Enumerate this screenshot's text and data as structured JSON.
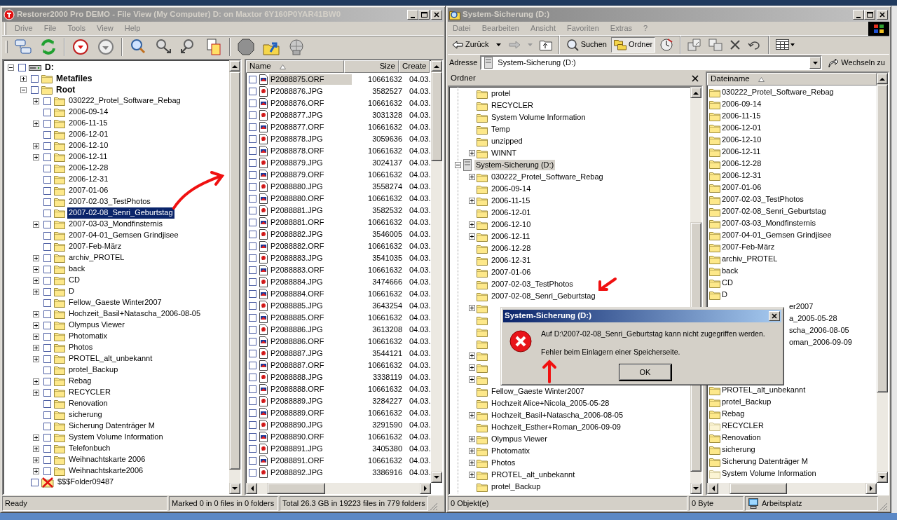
{
  "left_window": {
    "title": "Restorer2000 Pro DEMO - File View (My Computer) D: on Maxtor 6Y160P0YAR41BW0",
    "menu": [
      "Drive",
      "File",
      "Tools",
      "View",
      "Help"
    ],
    "tree": {
      "items": [
        {
          "label": "D:",
          "kind": "drive",
          "expanded": true,
          "checked": false,
          "selected": false,
          "children": [
            {
              "label": "Metafiles",
              "kind": "group",
              "expanded": false,
              "checked": false,
              "selected": false
            },
            {
              "label": "Root",
              "kind": "group",
              "expanded": true,
              "checked": false,
              "selected": false,
              "children": [
                {
                  "label": "030222_Protel_Software_Rebag",
                  "kind": "folder",
                  "expanded": false,
                  "checked": false,
                  "selected": false
                },
                {
                  "label": "2006-09-14",
                  "kind": "folder",
                  "checked": false,
                  "selected": false
                },
                {
                  "label": "2006-11-15",
                  "kind": "folder",
                  "expanded": false,
                  "checked": false,
                  "selected": false
                },
                {
                  "label": "2006-12-01",
                  "kind": "folder",
                  "checked": false,
                  "selected": false
                },
                {
                  "label": "2006-12-10",
                  "kind": "folder",
                  "expanded": false,
                  "checked": false,
                  "selected": false
                },
                {
                  "label": "2006-12-11",
                  "kind": "folder",
                  "expanded": false,
                  "checked": false,
                  "selected": false
                },
                {
                  "label": "2006-12-28",
                  "kind": "folder",
                  "checked": false,
                  "selected": false
                },
                {
                  "label": "2006-12-31",
                  "kind": "folder",
                  "checked": false,
                  "selected": false
                },
                {
                  "label": "2007-01-06",
                  "kind": "folder",
                  "checked": false,
                  "selected": false
                },
                {
                  "label": "2007-02-03_TestPhotos",
                  "kind": "folder",
                  "checked": false,
                  "selected": false
                },
                {
                  "label": "2007-02-08_Senri_Geburtstag",
                  "kind": "folder",
                  "checked": false,
                  "selected": true
                },
                {
                  "label": "2007-03-03_Mondfinsternis",
                  "kind": "folder",
                  "expanded": false,
                  "checked": false,
                  "selected": false
                },
                {
                  "label": "2007-04-01_Gemsen Grindjisee",
                  "kind": "folder",
                  "checked": false,
                  "selected": false
                },
                {
                  "label": "2007-Feb-März",
                  "kind": "folder",
                  "checked": false,
                  "selected": false
                },
                {
                  "label": "archiv_PROTEL",
                  "kind": "folder",
                  "expanded": false,
                  "checked": false,
                  "selected": false
                },
                {
                  "label": "back",
                  "kind": "folder",
                  "expanded": false,
                  "checked": false,
                  "selected": false
                },
                {
                  "label": "CD",
                  "kind": "folder",
                  "expanded": false,
                  "checked": false,
                  "selected": false
                },
                {
                  "label": "D",
                  "kind": "folder",
                  "expanded": false,
                  "checked": false,
                  "selected": false
                },
                {
                  "label": "Fellow_Gaeste Winter2007",
                  "kind": "folder",
                  "checked": false,
                  "selected": false
                },
                {
                  "label": "Hochzeit_Basil+Natascha_2006-08-05",
                  "kind": "folder",
                  "expanded": false,
                  "checked": false,
                  "selected": false
                },
                {
                  "label": "Olympus Viewer",
                  "kind": "folder",
                  "expanded": false,
                  "checked": false,
                  "selected": false
                },
                {
                  "label": "Photomatix",
                  "kind": "folder",
                  "expanded": false,
                  "checked": false,
                  "selected": false
                },
                {
                  "label": "Photos",
                  "kind": "folder",
                  "expanded": false,
                  "checked": false,
                  "selected": false
                },
                {
                  "label": "PROTEL_alt_unbekannt",
                  "kind": "folder",
                  "expanded": false,
                  "checked": false,
                  "selected": false
                },
                {
                  "label": "protel_Backup",
                  "kind": "folder",
                  "checked": false,
                  "selected": false
                },
                {
                  "label": "Rebag",
                  "kind": "folder",
                  "expanded": false,
                  "checked": false,
                  "selected": false
                },
                {
                  "label": "RECYCLER",
                  "kind": "folder",
                  "expanded": false,
                  "checked": false,
                  "selected": false
                },
                {
                  "label": "Renovation",
                  "kind": "folder",
                  "checked": false,
                  "selected": false
                },
                {
                  "label": "sicherung",
                  "kind": "folder",
                  "checked": false,
                  "selected": false
                },
                {
                  "label": "Sicherung Datenträger M",
                  "kind": "folder",
                  "checked": false,
                  "selected": false
                },
                {
                  "label": "System Volume Information",
                  "kind": "folder",
                  "expanded": false,
                  "checked": false,
                  "selected": false
                },
                {
                  "label": "Telefonbuch",
                  "kind": "folder",
                  "expanded": false,
                  "checked": false,
                  "selected": false
                },
                {
                  "label": "Weihnachtskarte 2006",
                  "kind": "folder",
                  "expanded": false,
                  "checked": false,
                  "selected": false
                },
                {
                  "label": "Weihnachtskarte2006",
                  "kind": "folder",
                  "expanded": false,
                  "checked": false,
                  "selected": false
                }
              ]
            },
            {
              "label": "$$$Folder09487",
              "kind": "deleted",
              "checked": false,
              "selected": false
            }
          ]
        }
      ]
    },
    "file_list": {
      "columns": [
        "Name",
        "Size",
        "Create"
      ],
      "rows": [
        {
          "name": "P2088875.ORF",
          "size": "10661632",
          "created": "04.03.",
          "kind": "orf",
          "checked": false,
          "selected": true
        },
        {
          "name": "P2088876.JPG",
          "size": "3582527",
          "created": "04.03.",
          "kind": "jpg",
          "checked": false,
          "selected": false
        },
        {
          "name": "P2088876.ORF",
          "size": "10661632",
          "created": "04.03.",
          "kind": "orf",
          "checked": false,
          "selected": false
        },
        {
          "name": "P2088877.JPG",
          "size": "3031328",
          "created": "04.03.",
          "kind": "jpg",
          "checked": false,
          "selected": false
        },
        {
          "name": "P2088877.ORF",
          "size": "10661632",
          "created": "04.03.",
          "kind": "orf",
          "checked": false,
          "selected": false
        },
        {
          "name": "P2088878.JPG",
          "size": "3059636",
          "created": "04.03.",
          "kind": "jpg",
          "checked": false,
          "selected": false
        },
        {
          "name": "P2088878.ORF",
          "size": "10661632",
          "created": "04.03.",
          "kind": "orf",
          "checked": false,
          "selected": false
        },
        {
          "name": "P2088879.JPG",
          "size": "3024137",
          "created": "04.03.",
          "kind": "jpg",
          "checked": false,
          "selected": false
        },
        {
          "name": "P2088879.ORF",
          "size": "10661632",
          "created": "04.03.",
          "kind": "orf",
          "checked": false,
          "selected": false
        },
        {
          "name": "P2088880.JPG",
          "size": "3558274",
          "created": "04.03.",
          "kind": "jpg",
          "checked": false,
          "selected": false
        },
        {
          "name": "P2088880.ORF",
          "size": "10661632",
          "created": "04.03.",
          "kind": "orf",
          "checked": false,
          "selected": false
        },
        {
          "name": "P2088881.JPG",
          "size": "3582532",
          "created": "04.03.",
          "kind": "jpg",
          "checked": false,
          "selected": false
        },
        {
          "name": "P2088881.ORF",
          "size": "10661632",
          "created": "04.03.",
          "kind": "orf",
          "checked": false,
          "selected": false
        },
        {
          "name": "P2088882.JPG",
          "size": "3546005",
          "created": "04.03.",
          "kind": "jpg",
          "checked": false,
          "selected": false
        },
        {
          "name": "P2088882.ORF",
          "size": "10661632",
          "created": "04.03.",
          "kind": "orf",
          "checked": false,
          "selected": false
        },
        {
          "name": "P2088883.JPG",
          "size": "3541035",
          "created": "04.03.",
          "kind": "jpg",
          "checked": false,
          "selected": false
        },
        {
          "name": "P2088883.ORF",
          "size": "10661632",
          "created": "04.03.",
          "kind": "orf",
          "checked": false,
          "selected": false
        },
        {
          "name": "P2088884.JPG",
          "size": "3474666",
          "created": "04.03.",
          "kind": "jpg",
          "checked": false,
          "selected": false
        },
        {
          "name": "P2088884.ORF",
          "size": "10661632",
          "created": "04.03.",
          "kind": "orf",
          "checked": false,
          "selected": false
        },
        {
          "name": "P2088885.JPG",
          "size": "3643254",
          "created": "04.03.",
          "kind": "jpg",
          "checked": false,
          "selected": false
        },
        {
          "name": "P2088885.ORF",
          "size": "10661632",
          "created": "04.03.",
          "kind": "orf",
          "checked": false,
          "selected": false
        },
        {
          "name": "P2088886.JPG",
          "size": "3613208",
          "created": "04.03.",
          "kind": "jpg",
          "checked": false,
          "selected": false
        },
        {
          "name": "P2088886.ORF",
          "size": "10661632",
          "created": "04.03.",
          "kind": "orf",
          "checked": false,
          "selected": false
        },
        {
          "name": "P2088887.JPG",
          "size": "3544121",
          "created": "04.03.",
          "kind": "jpg",
          "checked": false,
          "selected": false
        },
        {
          "name": "P2088887.ORF",
          "size": "10661632",
          "created": "04.03.",
          "kind": "orf",
          "checked": false,
          "selected": false
        },
        {
          "name": "P2088888.JPG",
          "size": "3338119",
          "created": "04.03.",
          "kind": "jpg",
          "checked": false,
          "selected": false
        },
        {
          "name": "P2088888.ORF",
          "size": "10661632",
          "created": "04.03.",
          "kind": "orf",
          "checked": false,
          "selected": false
        },
        {
          "name": "P2088889.JPG",
          "size": "3284227",
          "created": "04.03.",
          "kind": "jpg",
          "checked": false,
          "selected": false
        },
        {
          "name": "P2088889.ORF",
          "size": "10661632",
          "created": "04.03.",
          "kind": "orf",
          "checked": false,
          "selected": false
        },
        {
          "name": "P2088890.JPG",
          "size": "3291590",
          "created": "04.03.",
          "kind": "jpg",
          "checked": false,
          "selected": false
        },
        {
          "name": "P2088890.ORF",
          "size": "10661632",
          "created": "04.03.",
          "kind": "orf",
          "checked": false,
          "selected": false
        },
        {
          "name": "P2088891.JPG",
          "size": "3405380",
          "created": "04.03.",
          "kind": "jpg",
          "checked": false,
          "selected": false
        },
        {
          "name": "P2088891.ORF",
          "size": "10661632",
          "created": "04.03.",
          "kind": "orf",
          "checked": false,
          "selected": false
        },
        {
          "name": "P2088892.JPG",
          "size": "3386916",
          "created": "04.03.",
          "kind": "jpg",
          "checked": false,
          "selected": false
        }
      ]
    },
    "status_bar": [
      "Ready",
      "Marked 0 in 0 files in 0 folders",
      "Total 26.3 GB in 19223 files in 779 folders"
    ]
  },
  "right_window": {
    "title": "System-Sicherung (D:)",
    "menu": [
      "Datei",
      "Bearbeiten",
      "Ansicht",
      "Favoriten",
      "Extras",
      "?"
    ],
    "toolbar": {
      "buttons": [
        {
          "label": "Zurück",
          "pressed": false
        },
        {
          "label": "Suchen",
          "pressed": false
        },
        {
          "label": "Ordner",
          "pressed": true
        }
      ]
    },
    "address": {
      "label": "Adresse",
      "value": "System-Sicherung (D:)",
      "go_button": "Wechseln zu"
    },
    "folders_pane": {
      "title": "Ordner",
      "items": [
        {
          "kind": "offscreen",
          "children": [
            {
              "label": "protel",
              "kind": "folder",
              "selected": false
            },
            {
              "label": "RECYCLER",
              "kind": "folder",
              "selected": false
            },
            {
              "label": "System Volume Information",
              "kind": "folder",
              "selected": false
            },
            {
              "label": "Temp",
              "kind": "folder",
              "selected": false
            },
            {
              "label": "unzipped",
              "kind": "folder",
              "selected": false
            },
            {
              "label": "WINNT",
              "kind": "folder",
              "expanded": false,
              "selected": false
            }
          ]
        },
        {
          "label": "System-Sicherung (D:)",
          "kind": "drive",
          "expanded": true,
          "selected": true,
          "children": [
            {
              "label": "030222_Protel_Software_Rebag",
              "kind": "folder",
              "expanded": false,
              "selected": false
            },
            {
              "label": "2006-09-14",
              "kind": "folder",
              "selected": false
            },
            {
              "label": "2006-11-15",
              "kind": "folder",
              "expanded": false,
              "selected": false
            },
            {
              "label": "2006-12-01",
              "kind": "folder",
              "selected": false
            },
            {
              "label": "2006-12-10",
              "kind": "folder",
              "expanded": false,
              "selected": false
            },
            {
              "label": "2006-12-11",
              "kind": "folder",
              "expanded": false,
              "selected": false
            },
            {
              "label": "2006-12-28",
              "kind": "folder",
              "selected": false
            },
            {
              "label": "2006-12-31",
              "kind": "folder",
              "selected": false
            },
            {
              "label": "2007-01-06",
              "kind": "folder",
              "selected": false
            },
            {
              "label": "2007-02-03_TestPhotos",
              "kind": "folder",
              "selected": false
            },
            {
              "label": "2007-02-08_Senri_Geburtstag",
              "kind": "folder",
              "selected": false
            },
            {
              "kind": "covered",
              "expanded": false
            },
            {
              "kind": "covered"
            },
            {
              "kind": "covered"
            },
            {
              "kind": "covered"
            },
            {
              "kind": "covered",
              "expanded": false
            },
            {
              "kind": "covered",
              "expanded": false
            },
            {
              "kind": "covered",
              "expanded": false
            },
            {
              "label": "Fellow_Gaeste Winter2007",
              "kind": "folder",
              "selected": false
            },
            {
              "label": "Hochzeit Alice+Nicola_2005-05-28",
              "kind": "folder",
              "selected": false
            },
            {
              "label": "Hochzeit_Basil+Natascha_2006-08-05",
              "kind": "folder",
              "expanded": false,
              "selected": false
            },
            {
              "label": "Hochzeit_Esther+Roman_2006-09-09",
              "kind": "folder",
              "selected": false
            },
            {
              "label": "Olympus Viewer",
              "kind": "folder",
              "expanded": false,
              "selected": false
            },
            {
              "label": "Photomatix",
              "kind": "folder",
              "expanded": false,
              "selected": false
            },
            {
              "label": "Photos",
              "kind": "folder",
              "expanded": false,
              "selected": false
            },
            {
              "label": "PROTEL_alt_unbekannt",
              "kind": "folder",
              "expanded": false,
              "selected": false
            },
            {
              "label": "protel_Backup",
              "kind": "folder",
              "selected": false
            }
          ]
        }
      ]
    },
    "file_list": {
      "columns": [
        "Dateiname"
      ],
      "rows": [
        {
          "name": "030222_Protel_Software_Rebag",
          "kind": "folder",
          "selected": false
        },
        {
          "name": "2006-09-14",
          "kind": "folder",
          "selected": false
        },
        {
          "name": "2006-11-15",
          "kind": "folder",
          "selected": false
        },
        {
          "name": "2006-12-01",
          "kind": "folder",
          "selected": false
        },
        {
          "name": "2006-12-10",
          "kind": "folder",
          "selected": false
        },
        {
          "name": "2006-12-11",
          "kind": "folder",
          "selected": false
        },
        {
          "name": "2006-12-28",
          "kind": "folder",
          "selected": false
        },
        {
          "name": "2006-12-31",
          "kind": "folder",
          "selected": false
        },
        {
          "name": "2007-01-06",
          "kind": "folder",
          "selected": false
        },
        {
          "name": "2007-02-03_TestPhotos",
          "kind": "folder",
          "selected": false
        },
        {
          "name": "2007-02-08_Senri_Geburtstag",
          "kind": "folder",
          "selected": false
        },
        {
          "name": "2007-03-03_Mondfinsternis",
          "kind": "folder",
          "selected": false
        },
        {
          "name": "2007-04-01_Gemsen Grindjisee",
          "kind": "folder",
          "selected": false
        },
        {
          "name": "2007-Feb-März",
          "kind": "folder",
          "selected": false
        },
        {
          "name": "archiv_PROTEL",
          "kind": "folder",
          "selected": false
        },
        {
          "name": "back",
          "kind": "folder",
          "selected": false
        },
        {
          "name": "CD",
          "kind": "folder",
          "selected": false
        },
        {
          "name": "D",
          "kind": "folder",
          "selected": false
        },
        {
          "name": "er2007",
          "kind": "partial",
          "selected": false
        },
        {
          "name": "a_2005-05-28",
          "kind": "partial",
          "selected": false
        },
        {
          "name": "scha_2006-08-05",
          "kind": "partial",
          "selected": false
        },
        {
          "name": "oman_2006-09-09",
          "kind": "partial",
          "selected": false
        },
        {
          "kind": "covered"
        },
        {
          "kind": "covered"
        },
        {
          "kind": "covered"
        },
        {
          "name": "PROTEL_alt_unbekannt",
          "kind": "folder",
          "selected": false
        },
        {
          "name": "protel_Backup",
          "kind": "folder",
          "selected": false
        },
        {
          "name": "Rebag",
          "kind": "folder",
          "selected": false
        },
        {
          "name": "RECYCLER",
          "kind": "hidden_folder",
          "selected": false
        },
        {
          "name": "Renovation",
          "kind": "folder",
          "selected": false
        },
        {
          "name": "sicherung",
          "kind": "folder",
          "selected": false
        },
        {
          "name": "Sicherung Datenträger M",
          "kind": "folder",
          "selected": false
        },
        {
          "name": "System Volume Information",
          "kind": "hidden_folder",
          "selected": false
        }
      ]
    },
    "status_bar": [
      "0 Objekt(e)",
      "0 Byte",
      "Arbeitsplatz"
    ]
  },
  "dialog": {
    "title": "System-Sicherung (D:)",
    "message": [
      "Auf D:\\2007-02-08_Senri_Geburtstag kann nicht zugegriffen werden.",
      "Fehler beim Einlagern einer Speicherseite."
    ],
    "button": "OK"
  }
}
